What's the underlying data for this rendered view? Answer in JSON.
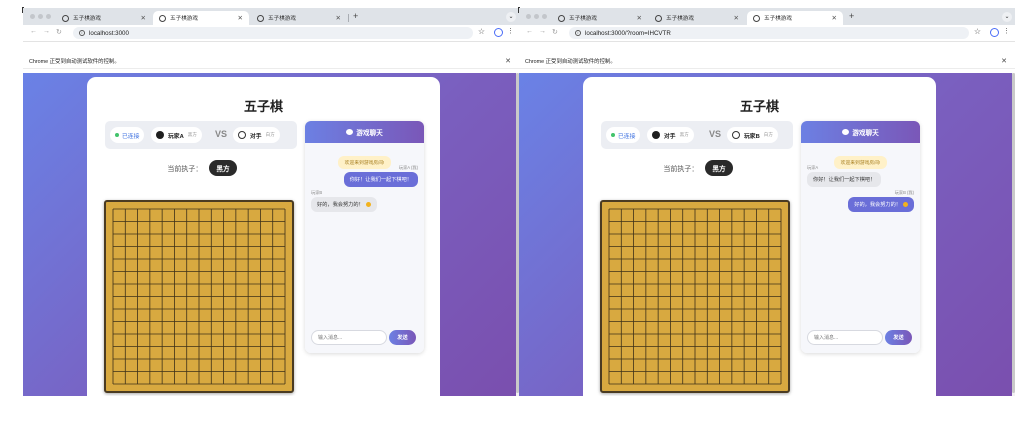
{
  "windows": [
    {
      "tabs": [
        {
          "title": "五子棋游戏",
          "active": false
        },
        {
          "title": "五子棋游戏",
          "active": true
        },
        {
          "title": "五子棋游戏",
          "active": false
        }
      ],
      "url": "localhost:3000",
      "infobar": "Chrome 正受到自动测试软件的控制。",
      "game_title": "五子棋",
      "status": "已连接",
      "player1": {
        "name": "玩家A",
        "side": "黑方"
      },
      "vs": "VS",
      "player2": {
        "name": "对手",
        "side": "白方"
      },
      "turn_label": "当前执子：",
      "turn_value": "黑方",
      "chat_title": "游戏聊天",
      "welcome": "欢迎来到游戏房间!",
      "messages": [
        {
          "meta": "玩家A (我)",
          "text": "你好！让我们一起下棋吧！",
          "mine": true
        },
        {
          "meta": "玩家B",
          "text": "好的，我会努力的！",
          "mine": false
        }
      ],
      "input_placeholder": "输入消息...",
      "send_label": "发送"
    },
    {
      "tabs": [
        {
          "title": "五子棋游戏",
          "active": false
        },
        {
          "title": "五子棋游戏",
          "active": false
        },
        {
          "title": "五子棋游戏",
          "active": true
        }
      ],
      "url": "localhost:3000/?room=IHCVTR",
      "infobar": "Chrome 正受到自动测试软件的控制。",
      "game_title": "五子棋",
      "status": "已连接",
      "player1": {
        "name": "对手",
        "side": "黑方"
      },
      "vs": "VS",
      "player2": {
        "name": "玩家B",
        "side": "白方"
      },
      "turn_label": "当前执子：",
      "turn_value": "黑方",
      "chat_title": "游戏聊天",
      "welcome": "欢迎来到游戏房间!",
      "messages": [
        {
          "meta": "玩家A",
          "text": "你好！让我们一起下棋吧！",
          "mine": false
        },
        {
          "meta": "玩家B (我)",
          "text": "好的，我会努力的！",
          "mine": true
        }
      ],
      "input_placeholder": "输入消息...",
      "send_label": "发送"
    }
  ],
  "icons": {
    "tab": "globe-icon",
    "close": "close-icon",
    "new_tab": "plus-icon",
    "back": "back-arrow-icon",
    "forward": "forward-arrow-icon",
    "reload": "reload-icon",
    "site_info": "info-icon",
    "bookmark": "star-icon",
    "profile": "profile-icon",
    "menu": "kebab-menu-icon",
    "chat": "chat-bubble-icon",
    "emoji": "emoji-icon"
  },
  "colors": {
    "background_start": "#6a82e6",
    "background_end": "#7a4fae",
    "board": "#d8a940",
    "board_line": "#3d3019",
    "accent": "#6a6ed8",
    "connected": "#42c36b",
    "welcome_bg": "#fff1c8"
  },
  "board": {
    "size": 15
  }
}
